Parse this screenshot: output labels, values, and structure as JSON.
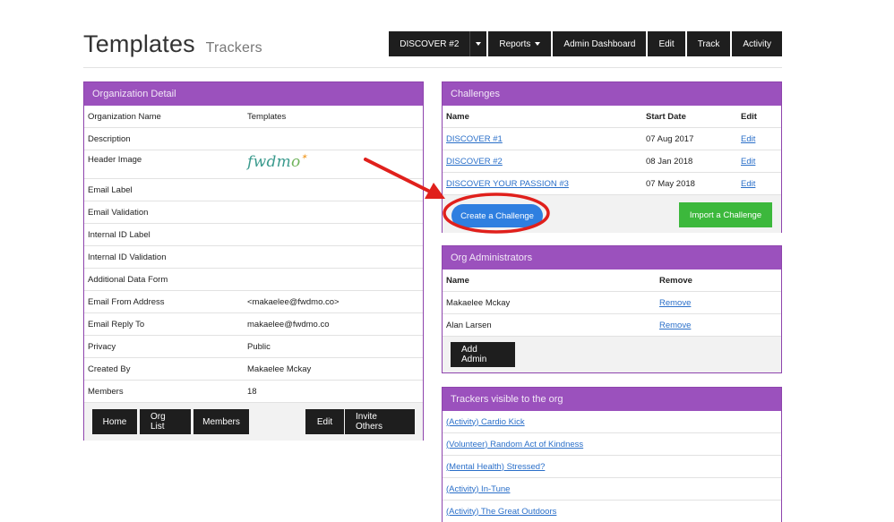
{
  "header": {
    "title": "Templates",
    "subtitle": "Trackers"
  },
  "topnav": {
    "discover": "DISCOVER #2",
    "reports": "Reports",
    "admin_dashboard": "Admin Dashboard",
    "edit": "Edit",
    "track": "Track",
    "activity": "Activity"
  },
  "org_detail": {
    "title": "Organization Detail",
    "rows": [
      {
        "label": "Organization Name",
        "value": "Templates"
      },
      {
        "label": "Description",
        "value": ""
      },
      {
        "label": "Header Image",
        "value": ""
      },
      {
        "label": "Email Label",
        "value": ""
      },
      {
        "label": "Email Validation",
        "value": ""
      },
      {
        "label": "Internal ID Label",
        "value": ""
      },
      {
        "label": "Internal ID Validation",
        "value": ""
      },
      {
        "label": "Additional Data Form",
        "value": ""
      },
      {
        "label": "Email From Address",
        "value": "<makaelee@fwdmo.co>"
      },
      {
        "label": "Email Reply To",
        "value": "makaelee@fwdmo.co"
      },
      {
        "label": "Privacy",
        "value": "Public"
      },
      {
        "label": "Created By",
        "value": "Makaelee Mckay"
      },
      {
        "label": "Members",
        "value": "18"
      }
    ],
    "logo": {
      "part1": "fwdm",
      "part2": "o",
      "star": "✶"
    },
    "buttons": {
      "home": "Home",
      "org_list": "Org List",
      "members": "Members",
      "edit": "Edit",
      "invite": "Invite Others"
    }
  },
  "challenges": {
    "title": "Challenges",
    "headers": {
      "name": "Name",
      "start": "Start Date",
      "edit": "Edit"
    },
    "rows": [
      {
        "name": "DISCOVER #1",
        "start": "07 Aug 2017",
        "edit": "Edit"
      },
      {
        "name": "DISCOVER #2",
        "start": "08 Jan 2018",
        "edit": "Edit"
      },
      {
        "name": "DISCOVER YOUR PASSION #3",
        "start": "07 May 2018",
        "edit": "Edit"
      }
    ],
    "create": "Create a Challenge",
    "import": "Import a Challenge"
  },
  "admins": {
    "title": "Org Administrators",
    "headers": {
      "name": "Name",
      "remove": "Remove"
    },
    "rows": [
      {
        "name": "Makaelee Mckay",
        "remove": "Remove"
      },
      {
        "name": "Alan Larsen",
        "remove": "Remove"
      }
    ],
    "add": "Add Admin"
  },
  "trackers": {
    "title": "Trackers visible to the org",
    "items": [
      "(Activity) Cardio Kick",
      "(Volunteer) Random Act of Kindness",
      "(Mental Health) Stressed?",
      "(Activity) In-Tune",
      "(Activity) The Great Outdoors"
    ]
  },
  "colors": {
    "panel_header": "#9b51bd",
    "annotation": "#e0201c",
    "primary": "#2f7fe0",
    "success": "#3cb83c"
  }
}
